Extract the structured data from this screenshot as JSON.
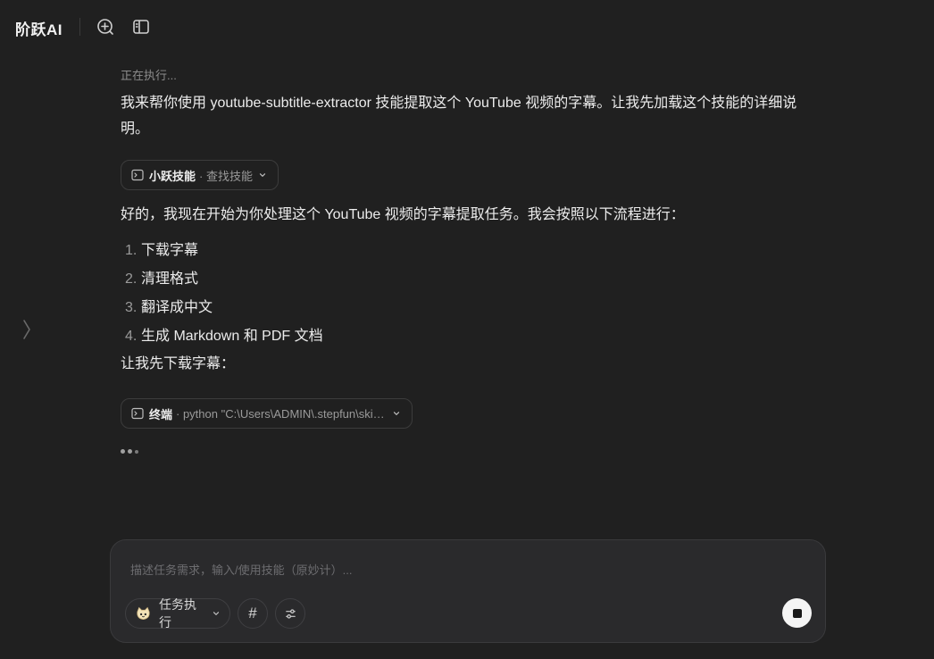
{
  "app": {
    "title": "阶跃AI"
  },
  "topbar": {
    "icons": [
      "new-chat-icon",
      "sidebar-toggle-icon"
    ]
  },
  "conversation": {
    "status": "正在执行...",
    "intro": "我来帮你使用 youtube-subtitle-extractor 技能提取这个 YouTube 视频的字幕。让我先加载这个技能的详细说明。",
    "tool_calls": [
      {
        "icon": "terminal-icon",
        "name": "小跃技能",
        "detail": "· 查找技能"
      },
      {
        "icon": "terminal-icon",
        "name": "终端",
        "detail": "· python \"C:\\Users\\ADMIN\\.stepfun\\skills\\youtube-subtitle-extractor\\scripts\\download.py\""
      }
    ],
    "plan_intro": "好的，我现在开始为你处理这个 YouTube 视频的字幕提取任务。我会按照以下流程进行：",
    "steps": [
      {
        "num": "1.",
        "text": "下载字幕"
      },
      {
        "num": "2.",
        "text": "清理格式"
      },
      {
        "num": "3.",
        "text": "翻译成中文"
      },
      {
        "num": "4.",
        "text": "生成 Markdown 和 PDF 文档"
      }
    ],
    "next": "让我先下载字幕："
  },
  "composer": {
    "placeholder": "描述任务需求，输入/使用技能（原妙计）...",
    "mode_label": "任务执行",
    "hash_label": "#"
  }
}
